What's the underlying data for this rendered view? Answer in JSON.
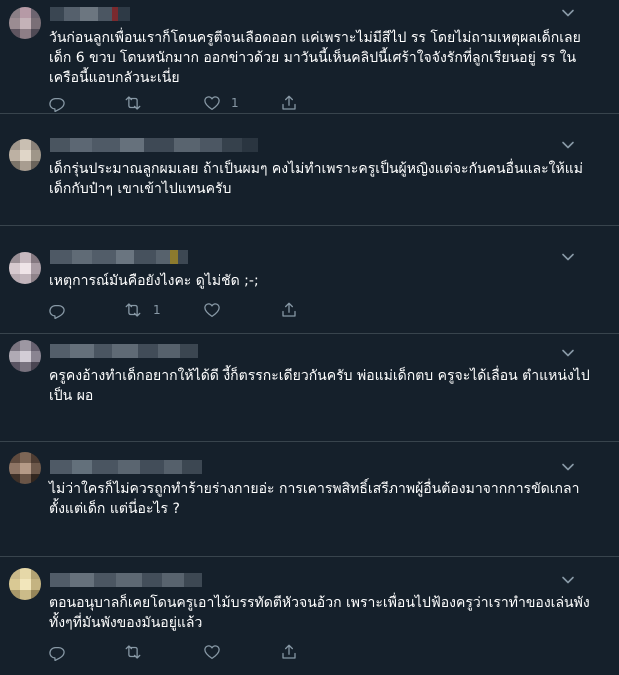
{
  "replies": [
    {
      "text": "วันก่อนลูกเพื่อนเราก็โดนครูตีจนเลือดออก แค่เพราะไม่มีสีไป รร โดยไม่ถามเหตุผลเด็กเลย เด็ก 6 ขวบ โดนหนักมาก ออกข่าวด้วย มาวันนี้เห็นคลิปนี้เศร้าใจจังรักที่ลูกเรียนอยู่ รร ในเครือนี้แอบกลัวนะเนี่ย",
      "reply_count": "",
      "retweet_count": "",
      "like_count": "1"
    },
    {
      "text": "เด็กรุ่นประมาณลูกผมเลย ถ้าเป็นผมๆ คงไม่ทำเพราะครูเป็นผู้หญิงแต่จะกันคนอื่นและให้แม่เด็กกับป๋าๆ เขาเข้าไปแทนครับ",
      "reply_count": "",
      "retweet_count": "",
      "like_count": ""
    },
    {
      "text": "เหตุการณ์มันคือยังไงคะ ดูไม่ชัด ;-;",
      "reply_count": "",
      "retweet_count": "1",
      "like_count": ""
    },
    {
      "text": "ครูคงอ้างทำเด็กอยากให้ได้ดี งี้ก็ตรรกะเดียวกันครับ พ่อแม่เด็กตบ ครูจะได้เลื่อน ตำแหน่งไปเป็น ผอ",
      "reply_count": "",
      "retweet_count": "",
      "like_count": ""
    },
    {
      "text": "ไม่ว่าใครก็ไม่ควรถูกทำร้ายร่างกายอ่ะ การเคารพสิทธิ์เสรีภาพผู้อื่นต้องมาจากการขัดเกลาตั้งแต่เด็ก แต่นี่อะไร ?",
      "reply_count": "",
      "retweet_count": "",
      "like_count": ""
    },
    {
      "text": "ตอนอนุบาลก็เคยโดนครูเอาไม้บรรทัดตีหัวจนอ้วก เพราะเพื่อนไปฟ้องครูว่าเราทำของเล่นพังทั้งๆที่มันพังของมันอยู่แล้ว",
      "reply_count": "",
      "retweet_count": "",
      "like_count": ""
    }
  ],
  "colors": {
    "background": "#15202b",
    "text": "#ffffff",
    "secondary": "#8899a6",
    "divider": "#38444d"
  },
  "icons": [
    "reply-icon",
    "retweet-icon",
    "like-icon",
    "share-icon",
    "chevron-down-icon"
  ]
}
